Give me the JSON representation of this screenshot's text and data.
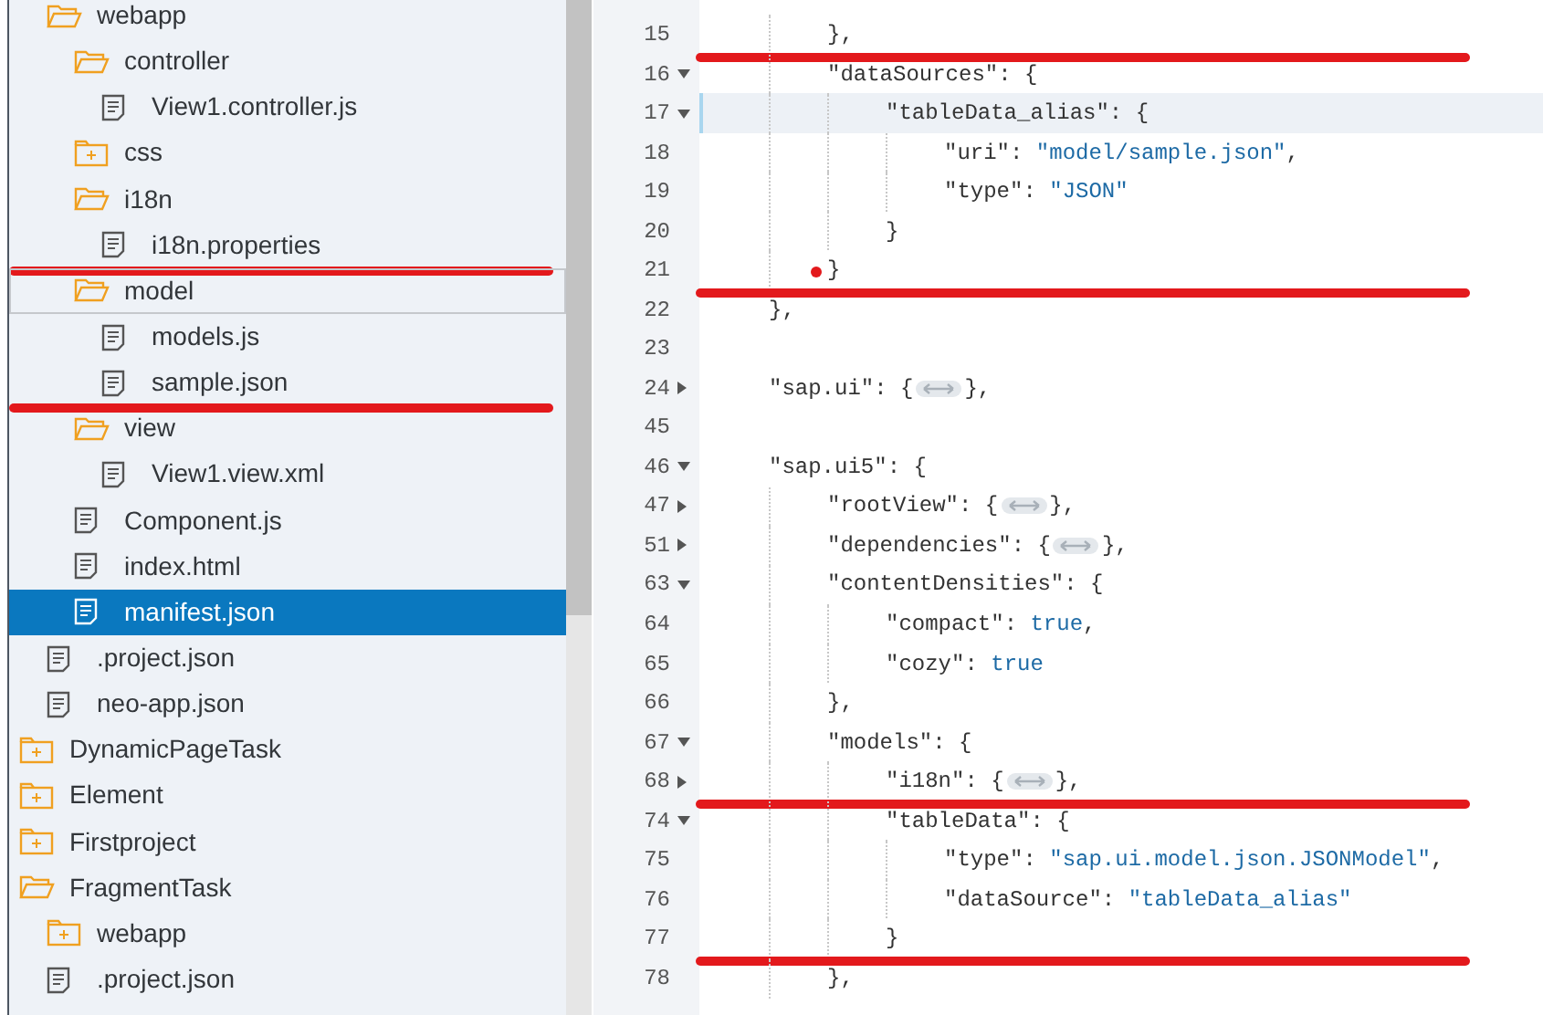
{
  "tree": {
    "items": [
      {
        "kind": "hidden",
        "children": [
          {
            "label": "webapp",
            "kind": "folder",
            "expanded": true,
            "selected": false,
            "hovered": false,
            "annotated": false,
            "children": [
              {
                "label": "controller",
                "kind": "folder",
                "expanded": true,
                "selected": false,
                "hovered": false,
                "annotated": false,
                "children": [
                  {
                    "label": "View1.controller.js",
                    "kind": "file",
                    "selected": false,
                    "hovered": false,
                    "annotated": false
                  }
                ]
              },
              {
                "label": "css",
                "kind": "folder",
                "expanded": false,
                "selected": false,
                "hovered": false,
                "annotated": false
              },
              {
                "label": "i18n",
                "kind": "folder",
                "expanded": true,
                "selected": false,
                "hovered": false,
                "annotated": false,
                "children": [
                  {
                    "label": "i18n.properties",
                    "kind": "file",
                    "selected": false,
                    "hovered": false,
                    "annotated": true
                  }
                ]
              },
              {
                "label": "model",
                "kind": "folder",
                "expanded": true,
                "selected": false,
                "hovered": true,
                "annotated": false,
                "children": [
                  {
                    "label": "models.js",
                    "kind": "file",
                    "selected": false,
                    "hovered": false,
                    "annotated": false
                  },
                  {
                    "label": "sample.json",
                    "kind": "file",
                    "selected": false,
                    "hovered": false,
                    "annotated": true
                  }
                ]
              },
              {
                "label": "view",
                "kind": "folder",
                "expanded": true,
                "selected": false,
                "hovered": false,
                "annotated": false,
                "children": [
                  {
                    "label": "View1.view.xml",
                    "kind": "file",
                    "selected": false,
                    "hovered": false,
                    "annotated": false
                  }
                ]
              },
              {
                "label": "Component.js",
                "kind": "file",
                "selected": false,
                "hovered": false,
                "annotated": false
              },
              {
                "label": "index.html",
                "kind": "file",
                "selected": false,
                "hovered": false,
                "annotated": false
              },
              {
                "label": "manifest.json",
                "kind": "file",
                "selected": true,
                "hovered": false,
                "annotated": false
              }
            ]
          },
          {
            "label": ".project.json",
            "kind": "file",
            "selected": false,
            "hovered": false,
            "annotated": false
          },
          {
            "label": "neo-app.json",
            "kind": "file",
            "selected": false,
            "hovered": false,
            "annotated": false
          }
        ]
      },
      {
        "label": "DynamicPageTask",
        "kind": "folder",
        "expanded": false,
        "selected": false,
        "hovered": false,
        "annotated": false
      },
      {
        "label": "Element",
        "kind": "folder",
        "expanded": false,
        "selected": false,
        "hovered": false,
        "annotated": false
      },
      {
        "label": "Firstproject",
        "kind": "folder",
        "expanded": false,
        "selected": false,
        "hovered": false,
        "annotated": false
      },
      {
        "label": "FragmentTask",
        "kind": "folder",
        "expanded": true,
        "selected": false,
        "hovered": false,
        "annotated": false,
        "children": [
          {
            "label": "webapp",
            "kind": "folder",
            "expanded": false,
            "selected": false,
            "hovered": false,
            "annotated": false
          },
          {
            "label": ".project.json",
            "kind": "file",
            "selected": false,
            "hovered": false,
            "annotated": false
          }
        ]
      }
    ]
  },
  "editor": {
    "lines": [
      {
        "number": "15",
        "current": false,
        "marker": false,
        "annotated": true,
        "tokens": [
          {
            "kind": "close",
            "text": "}"
          },
          {
            "kind": "punct",
            "text": ","
          }
        ]
      },
      {
        "number": "16",
        "foldable": true,
        "expanded": true,
        "current": false,
        "marker": false,
        "annotated": false,
        "tokens": [
          {
            "kind": "key",
            "text": "\"dataSources\""
          },
          {
            "kind": "punct",
            "text": ": "
          },
          {
            "kind": "open",
            "text": "{"
          }
        ]
      },
      {
        "number": "17",
        "foldable": true,
        "expanded": true,
        "current": true,
        "marker": false,
        "annotated": false,
        "tokens": [
          {
            "kind": "key",
            "text": "\"tableData_alias\""
          },
          {
            "kind": "punct",
            "text": ": "
          },
          {
            "kind": "open",
            "text": "{"
          }
        ]
      },
      {
        "number": "18",
        "current": false,
        "marker": false,
        "annotated": false,
        "tokens": [
          {
            "kind": "key",
            "text": "\"uri\""
          },
          {
            "kind": "punct",
            "text": ": "
          },
          {
            "kind": "string",
            "text": "\"model/sample.json\""
          },
          {
            "kind": "punct",
            "text": ","
          }
        ]
      },
      {
        "number": "19",
        "current": false,
        "marker": false,
        "annotated": false,
        "tokens": [
          {
            "kind": "key",
            "text": "\"type\""
          },
          {
            "kind": "punct",
            "text": ": "
          },
          {
            "kind": "string",
            "text": "\"JSON\""
          }
        ]
      },
      {
        "number": "20",
        "current": false,
        "marker": false,
        "annotated": false,
        "tokens": [
          {
            "kind": "close",
            "text": "}"
          }
        ]
      },
      {
        "number": "21",
        "current": false,
        "marker": true,
        "annotated": true,
        "tokens": [
          {
            "kind": "close",
            "text": "}"
          }
        ]
      },
      {
        "number": "22",
        "current": false,
        "marker": false,
        "annotated": false,
        "tokens": [
          {
            "kind": "close",
            "text": "}"
          },
          {
            "kind": "punct",
            "text": ","
          }
        ]
      },
      {
        "number": "23",
        "current": false,
        "marker": false,
        "annotated": false
      },
      {
        "number": "24",
        "foldable": true,
        "expanded": false,
        "current": false,
        "marker": false,
        "annotated": false,
        "tokens": [
          {
            "kind": "key",
            "text": "\"sap.ui\""
          },
          {
            "kind": "punct",
            "text": ": "
          },
          {
            "kind": "open",
            "text": "{"
          },
          {
            "kind": "fold"
          },
          {
            "kind": "close",
            "text": "}"
          },
          {
            "kind": "punct",
            "text": ","
          }
        ]
      },
      {
        "number": "45",
        "current": false,
        "marker": false,
        "annotated": false
      },
      {
        "number": "46",
        "foldable": true,
        "expanded": true,
        "current": false,
        "marker": false,
        "annotated": false,
        "tokens": [
          {
            "kind": "key",
            "text": "\"sap.ui5\""
          },
          {
            "kind": "punct",
            "text": ": "
          },
          {
            "kind": "open",
            "text": "{"
          }
        ]
      },
      {
        "number": "47",
        "foldable": true,
        "expanded": false,
        "current": false,
        "marker": false,
        "annotated": false,
        "tokens": [
          {
            "kind": "key",
            "text": "\"rootView\""
          },
          {
            "kind": "punct",
            "text": ": "
          },
          {
            "kind": "open",
            "text": "{"
          },
          {
            "kind": "fold"
          },
          {
            "kind": "close",
            "text": "}"
          },
          {
            "kind": "punct",
            "text": ","
          }
        ]
      },
      {
        "number": "51",
        "foldable": true,
        "expanded": false,
        "current": false,
        "marker": false,
        "annotated": false,
        "tokens": [
          {
            "kind": "key",
            "text": "\"dependencies\""
          },
          {
            "kind": "punct",
            "text": ": "
          },
          {
            "kind": "open",
            "text": "{"
          },
          {
            "kind": "fold"
          },
          {
            "kind": "close",
            "text": "}"
          },
          {
            "kind": "punct",
            "text": ","
          }
        ]
      },
      {
        "number": "63",
        "foldable": true,
        "expanded": true,
        "current": false,
        "marker": false,
        "annotated": false,
        "tokens": [
          {
            "kind": "key",
            "text": "\"contentDensities\""
          },
          {
            "kind": "punct",
            "text": ": "
          },
          {
            "kind": "open",
            "text": "{"
          }
        ]
      },
      {
        "number": "64",
        "current": false,
        "marker": false,
        "annotated": false,
        "tokens": [
          {
            "kind": "key",
            "text": "\"compact\""
          },
          {
            "kind": "punct",
            "text": ": "
          },
          {
            "kind": "literal",
            "text": "true"
          },
          {
            "kind": "punct",
            "text": ","
          }
        ]
      },
      {
        "number": "65",
        "current": false,
        "marker": false,
        "annotated": false,
        "tokens": [
          {
            "kind": "key",
            "text": "\"cozy\""
          },
          {
            "kind": "punct",
            "text": ": "
          },
          {
            "kind": "literal",
            "text": "true"
          }
        ]
      },
      {
        "number": "66",
        "current": false,
        "marker": false,
        "annotated": false,
        "tokens": [
          {
            "kind": "close",
            "text": "}"
          },
          {
            "kind": "punct",
            "text": ","
          }
        ]
      },
      {
        "number": "67",
        "foldable": true,
        "expanded": true,
        "current": false,
        "marker": false,
        "annotated": false,
        "tokens": [
          {
            "kind": "key",
            "text": "\"models\""
          },
          {
            "kind": "punct",
            "text": ": "
          },
          {
            "kind": "open",
            "text": "{"
          }
        ]
      },
      {
        "number": "68",
        "foldable": true,
        "expanded": false,
        "current": false,
        "marker": false,
        "annotated": true,
        "tokens": [
          {
            "kind": "key",
            "text": "\"i18n\""
          },
          {
            "kind": "punct",
            "text": ": "
          },
          {
            "kind": "open",
            "text": "{"
          },
          {
            "kind": "fold"
          },
          {
            "kind": "close",
            "text": "}"
          },
          {
            "kind": "punct",
            "text": ","
          }
        ]
      },
      {
        "number": "74",
        "foldable": true,
        "expanded": true,
        "current": false,
        "marker": false,
        "annotated": false,
        "tokens": [
          {
            "kind": "key",
            "text": "\"tableData\""
          },
          {
            "kind": "punct",
            "text": ": "
          },
          {
            "kind": "open",
            "text": "{"
          }
        ]
      },
      {
        "number": "75",
        "current": false,
        "marker": false,
        "annotated": false,
        "tokens": [
          {
            "kind": "key",
            "text": "\"type\""
          },
          {
            "kind": "punct",
            "text": ": "
          },
          {
            "kind": "string",
            "text": "\"sap.ui.model.json.JSONModel\""
          },
          {
            "kind": "punct",
            "text": ","
          }
        ]
      },
      {
        "number": "76",
        "current": false,
        "marker": false,
        "annotated": false,
        "tokens": [
          {
            "kind": "key",
            "text": "\"dataSource\""
          },
          {
            "kind": "punct",
            "text": ": "
          },
          {
            "kind": "string",
            "text": "\"tableData_alias\""
          }
        ]
      },
      {
        "number": "77",
        "current": false,
        "marker": false,
        "annotated": true,
        "tokens": [
          {
            "kind": "close",
            "text": "}"
          }
        ]
      },
      {
        "number": "78",
        "current": false,
        "marker": false,
        "annotated": false,
        "tokens": [
          {
            "kind": "close",
            "text": "}"
          },
          {
            "kind": "punct",
            "text": ","
          }
        ]
      }
    ]
  }
}
